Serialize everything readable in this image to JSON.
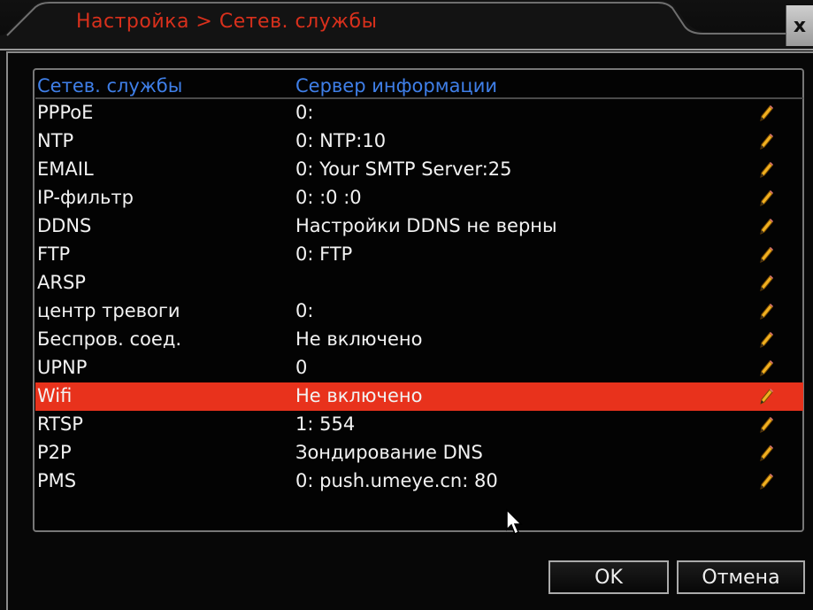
{
  "window": {
    "title": "Настройка > Сетев. службы",
    "close_label": "x"
  },
  "table": {
    "headers": {
      "name": "Сетев. службы",
      "info": "Сервер информации"
    },
    "rows": [
      {
        "name": "PPPoE",
        "info": "0:"
      },
      {
        "name": "NTP",
        "info": "0: NTP:10"
      },
      {
        "name": "EMAIL",
        "info": "0: Your SMTP Server:25"
      },
      {
        "name": "IP-фильтр",
        "info": "0: :0 :0"
      },
      {
        "name": "DDNS",
        "info": "Настройки DDNS не верны"
      },
      {
        "name": "FTP",
        "info": "0: FTP"
      },
      {
        "name": "ARSP",
        "info": ""
      },
      {
        "name": "центр тревоги",
        "info": "0:"
      },
      {
        "name": "Беспров. соед.",
        "info": "Не включено"
      },
      {
        "name": "UPNP",
        "info": "0"
      },
      {
        "name": "Wifi",
        "info": "Не включено",
        "selected": true
      },
      {
        "name": "RTSP",
        "info": "1: 554"
      },
      {
        "name": "P2P",
        "info": "Зондирование DNS"
      },
      {
        "name": "PMS",
        "info": "0: push.umeye.cn: 80"
      }
    ],
    "edit_icon": "pencil-icon"
  },
  "buttons": {
    "ok": "OK",
    "cancel": "Отмена"
  },
  "colors": {
    "title": "#d8301c",
    "header": "#3f7fe8",
    "selected_row": "#e8321c"
  }
}
